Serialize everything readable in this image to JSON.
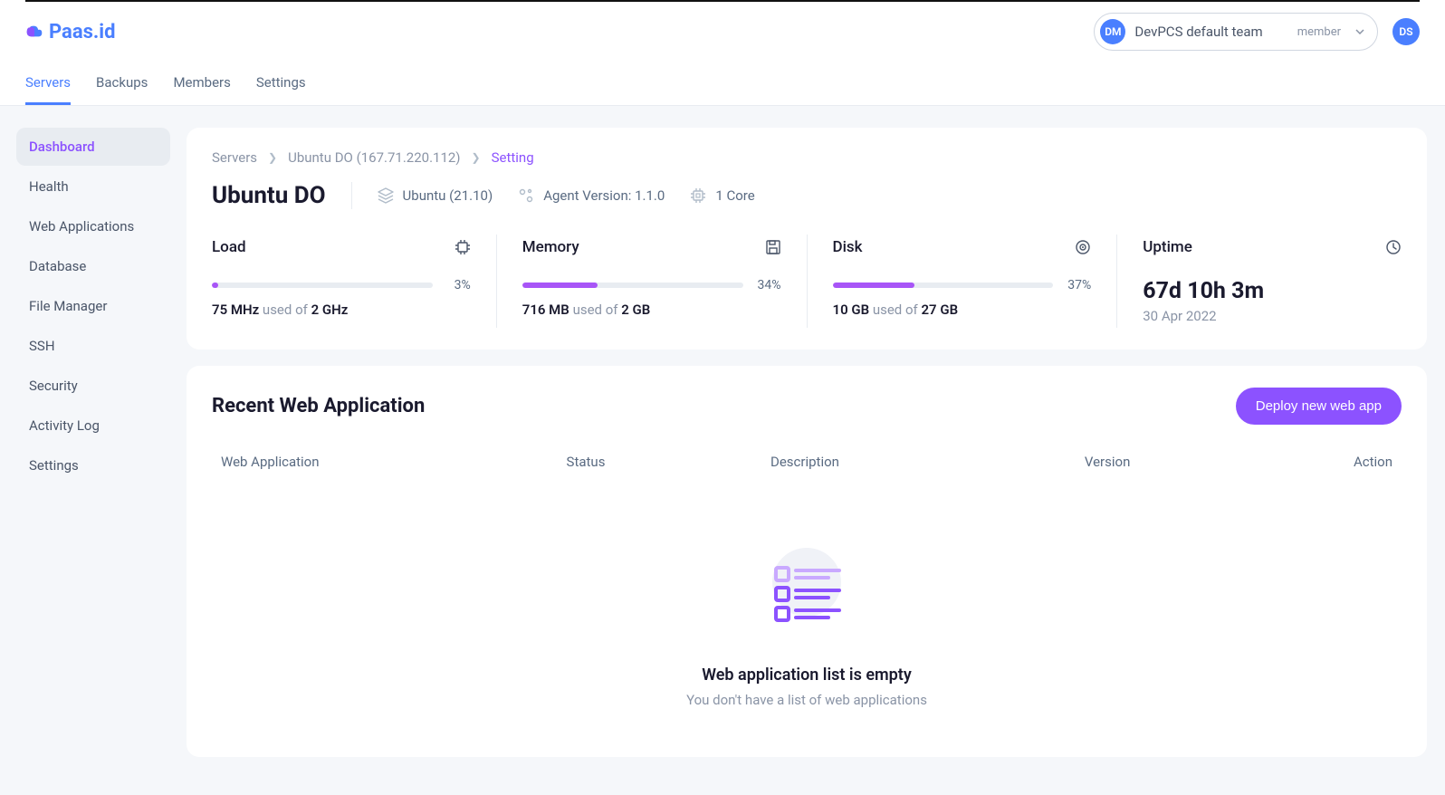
{
  "brand": "Paas.id",
  "team": {
    "avatar": "DM",
    "name": "DevPCS default team",
    "role": "member"
  },
  "user_avatar": "DS",
  "main_nav": {
    "servers": "Servers",
    "backups": "Backups",
    "members": "Members",
    "settings": "Settings"
  },
  "sidebar": {
    "dashboard": "Dashboard",
    "health": "Health",
    "webapps": "Web Applications",
    "database": "Database",
    "filemanager": "File Manager",
    "ssh": "SSH",
    "security": "Security",
    "activitylog": "Activity Log",
    "settings": "Settings"
  },
  "breadcrumb": {
    "servers": "Servers",
    "server": "Ubuntu DO (167.71.220.112)",
    "current": "Setting"
  },
  "server": {
    "name": "Ubuntu DO",
    "os": "Ubuntu (21.10)",
    "agent": "Agent Version: 1.1.0",
    "cores": "1 Core"
  },
  "metrics": {
    "load": {
      "label": "Load",
      "pct": "3%",
      "pct_num": 3,
      "used": "75 MHz",
      "total": "2 GHz"
    },
    "memory": {
      "label": "Memory",
      "pct": "34%",
      "pct_num": 34,
      "used": "716 MB",
      "total": "2 GB"
    },
    "disk": {
      "label": "Disk",
      "pct": "37%",
      "pct_num": 37,
      "used": "10 GB",
      "total": "27 GB"
    },
    "uptime": {
      "label": "Uptime",
      "value": "67d 10h 3m",
      "date": "30 Apr 2022"
    },
    "used_of": " used of "
  },
  "webapps": {
    "title": "Recent Web Application",
    "deploy_btn": "Deploy new web app",
    "cols": {
      "app": "Web Application",
      "status": "Status",
      "desc": "Description",
      "version": "Version",
      "action": "Action"
    },
    "empty_title": "Web application list is empty",
    "empty_sub": "You don't have a list of web applications"
  }
}
